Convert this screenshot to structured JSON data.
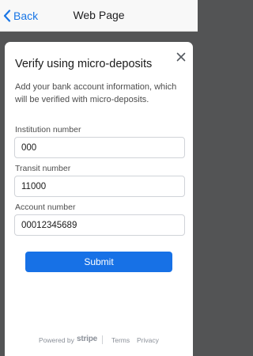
{
  "navbar": {
    "back_label": "Back",
    "title": "Web Page"
  },
  "modal": {
    "title": "Verify using micro-deposits",
    "description": "Add your bank account information, which will be verified with micro-deposits.",
    "fields": [
      {
        "label": "Institution number",
        "value": "000"
      },
      {
        "label": "Transit number",
        "value": "11000"
      },
      {
        "label": "Account number",
        "value": "00012345689"
      }
    ],
    "submit_label": "Submit"
  },
  "footer": {
    "powered_by": "Powered by",
    "brand": "stripe",
    "terms": "Terms",
    "privacy": "Privacy"
  },
  "colors": {
    "accent": "#1771e6",
    "backdrop": "#535455"
  },
  "icons": {
    "back": "chevron-left-icon",
    "close": "close-icon"
  }
}
